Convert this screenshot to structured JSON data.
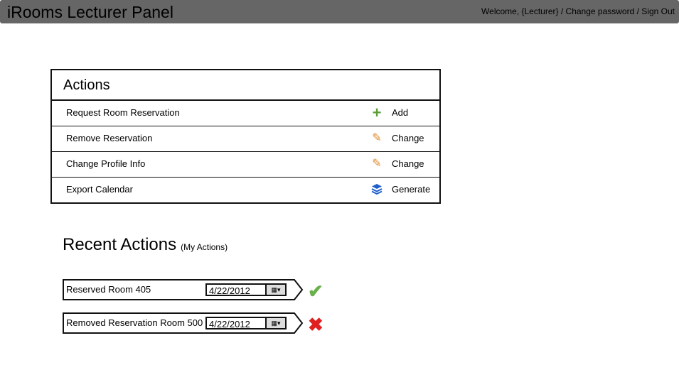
{
  "header": {
    "title": "iRooms Lecturer Panel",
    "welcome": "Welcome, {Lecturer}",
    "sep": " / ",
    "change_password": "Change password",
    "sign_out": "Sign Out"
  },
  "actions": {
    "title": "Actions",
    "rows": [
      {
        "label": "Request Room Reservation",
        "icon": "plus-icon",
        "action": "Add",
        "color": "#5a9e3a"
      },
      {
        "label": "Remove Reservation",
        "icon": "pencil-icon",
        "action": "Change",
        "color": "#e08a2a"
      },
      {
        "label": "Change Profile Info",
        "icon": "pencil-icon",
        "action": "Change",
        "color": "#e08a2a"
      },
      {
        "label": "Export Calendar",
        "icon": "layers-icon",
        "action": "Generate",
        "color": "#1f5fc8"
      }
    ]
  },
  "recent": {
    "title": "Recent Actions",
    "subtitle": "(My Actions)",
    "items": [
      {
        "text": "Reserved Room 405",
        "date": "4/22/2012",
        "status": "check-icon",
        "mark": "✔",
        "color": "#6ab04c"
      },
      {
        "text": "Removed Reservation Room 500",
        "date": "4/22/2012",
        "status": "cross-icon",
        "mark": "✖",
        "color": "#e02020"
      }
    ]
  }
}
